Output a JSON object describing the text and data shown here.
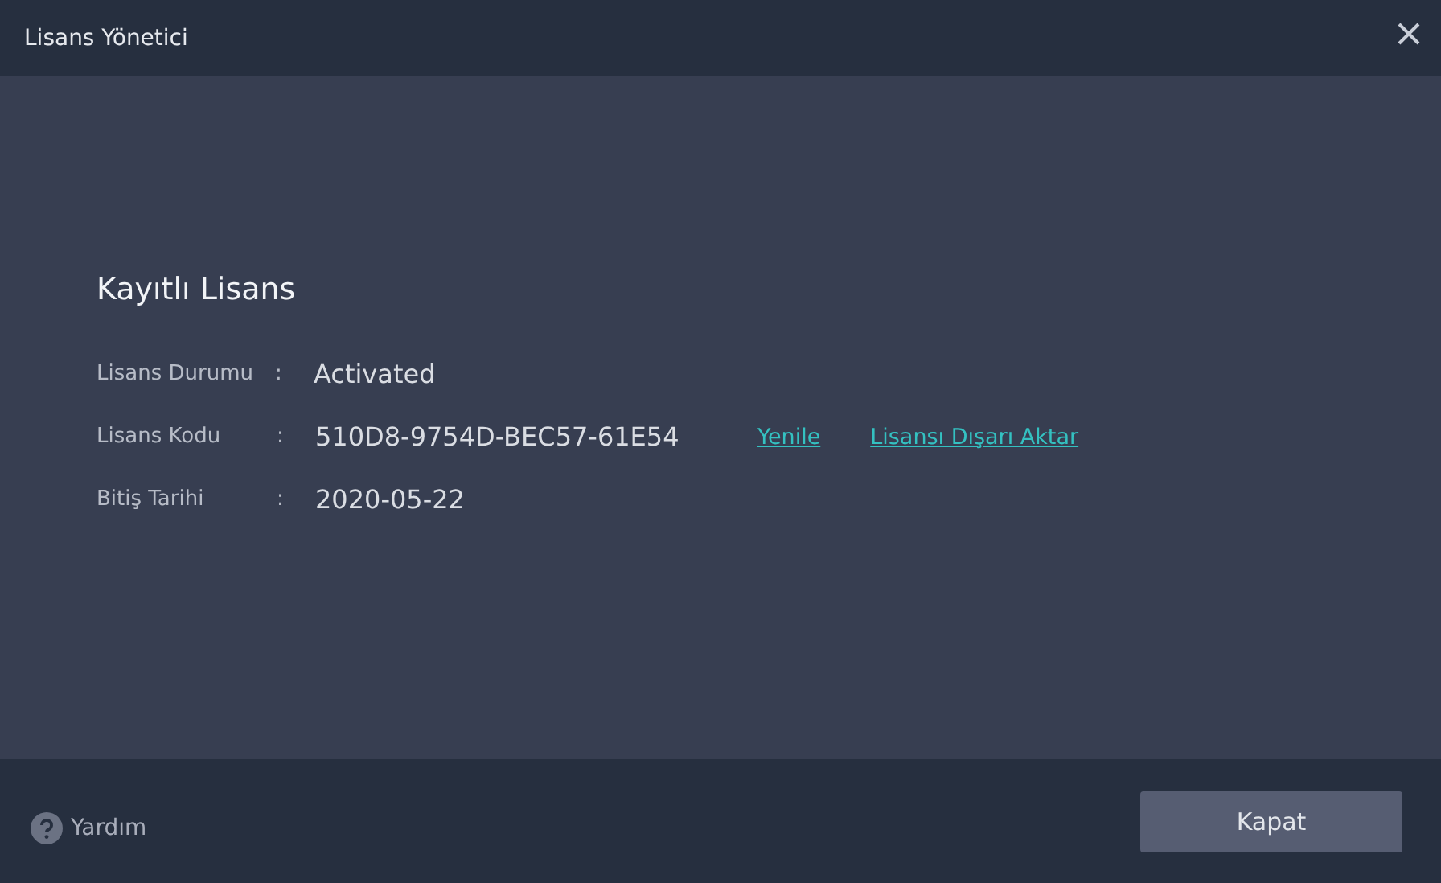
{
  "window": {
    "title": "Lisans Yönetici"
  },
  "section_title": "Kayıtlı Lisans",
  "fields": [
    {
      "label": "Lisans Durumu",
      "separator": ":",
      "value": "Activated"
    },
    {
      "label": "Lisans Kodu",
      "separator": ":",
      "value": "510D8-9754D-BEC57-61E54",
      "links": [
        "Yenile",
        "Lisansı Dışarı Aktar"
      ]
    },
    {
      "label": "Bitiş Tarihi",
      "separator": ":",
      "value": "2020-05-22"
    }
  ],
  "footer": {
    "help": "Yardım",
    "button": "Kapat"
  }
}
